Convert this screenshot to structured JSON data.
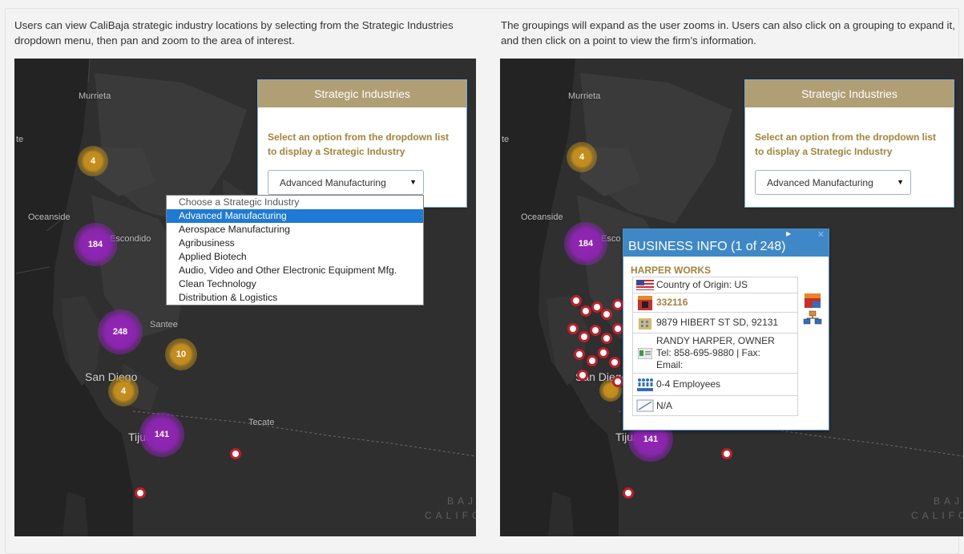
{
  "captions": {
    "left": "Users can view CaliBaja strategic industry locations by selecting from the Strategic Industries dropdown menu, then pan and zoom to the area of interest.",
    "right": "The groupings will expand as the user zooms in. Users can also click on a grouping to expand it, and then click on a point to view the firm's information."
  },
  "places": {
    "murrieta": "Murrieta",
    "edge_te": "te",
    "oceanside": "Oceanside",
    "escondido": "Escondido",
    "escondido_cut": "Esco",
    "santee": "Santee",
    "san_diego": "San Diego",
    "tecate": "Tecate",
    "tijuana": "Tijuana",
    "baja_line1": "BAJA",
    "baja_line2": "CALIFO"
  },
  "clusters": {
    "left": [
      "4",
      "184",
      "248",
      "10",
      "4",
      "141"
    ],
    "right": [
      "4",
      "184",
      "141"
    ]
  },
  "panel": {
    "title": "Strategic Industries",
    "instruction": "Select an option from the dropdown list to display a Strategic Industry",
    "selected": "Advanced Manufacturing"
  },
  "dropdown": {
    "options": [
      "Choose a Strategic Industry",
      "Advanced Manufacturing",
      "Aerospace Manufacturing",
      "Agribusiness",
      "Applied Biotech",
      "Audio, Video and Other Electronic Equipment Mfg.",
      "Clean Technology",
      "Distribution & Logistics"
    ],
    "highlighted_index": 1
  },
  "popup": {
    "title": "BUSINESS INFO (1 of 248)",
    "next_icon": "triangle-right-icon",
    "close_icon": "close-icon",
    "business_name": "HARPER WORKS",
    "country": "Country of Origin: US",
    "naics_code": "332116",
    "address": "9879 HIBERT ST SD, 92131",
    "contact_name": "RANDY HARPER, OWNER",
    "contact_phone": "Tel: 858-695-9880 | Fax:",
    "contact_email": "Email:",
    "employees": "0-4 Employees",
    "extra": "N/A"
  },
  "colors": {
    "map_background": "#2f2f2f",
    "cluster_purple": "#8d26b1",
    "cluster_gold": "#c18c1d",
    "panel_header": "#b09f75",
    "instruction_text": "#a5833a",
    "popup_header": "#3f88c7",
    "dropdown_highlight": "#1e7ad5",
    "pin_border": "#c0202a"
  }
}
